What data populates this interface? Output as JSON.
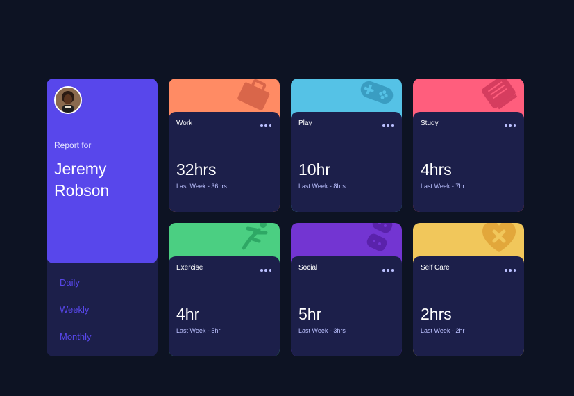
{
  "profile": {
    "report_label": "Report for",
    "name": "Jeremy Robson",
    "periods": [
      "Daily",
      "Weekly",
      "Monthly"
    ]
  },
  "cards": [
    {
      "title": "Work",
      "hours": "32hrs",
      "previous": "Last Week - 36hrs",
      "color": "#ff8b64",
      "icon": "briefcase-icon"
    },
    {
      "title": "Play",
      "hours": "10hr",
      "previous": "Last Week - 8hrs",
      "color": "#55c2e6",
      "icon": "gamepad-icon"
    },
    {
      "title": "Study",
      "hours": "4hrs",
      "previous": "Last Week - 7hr",
      "color": "#ff5e7d",
      "icon": "book-icon"
    },
    {
      "title": "Exercise",
      "hours": "4hr",
      "previous": "Last Week - 5hr",
      "color": "#4bcf82",
      "icon": "runner-icon"
    },
    {
      "title": "Social",
      "hours": "5hr",
      "previous": "Last Week - 3hrs",
      "color": "#7335d2",
      "icon": "controllers-icon"
    },
    {
      "title": "Self Care",
      "hours": "2hrs",
      "previous": "Last Week - 2hr",
      "color": "#f1c75b",
      "icon": "heart-bandage-icon"
    }
  ]
}
